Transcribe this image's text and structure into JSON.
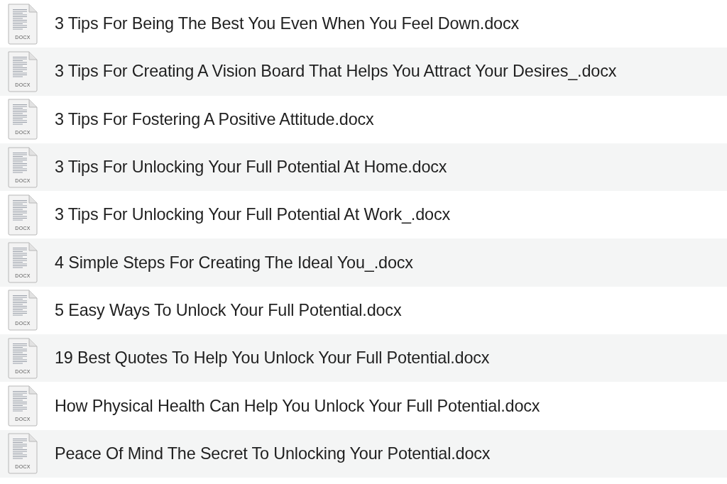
{
  "files": [
    {
      "name": "3 Tips For Being The Best You Even When You Feel Down.docx",
      "type_label": "DOCX"
    },
    {
      "name": "3 Tips For Creating A Vision Board That Helps You Attract Your Desires_.docx",
      "type_label": "DOCX"
    },
    {
      "name": "3 Tips For Fostering A Positive Attitude.docx",
      "type_label": "DOCX"
    },
    {
      "name": "3 Tips For Unlocking Your Full Potential At Home.docx",
      "type_label": "DOCX"
    },
    {
      "name": "3 Tips For Unlocking Your Full Potential At Work_.docx",
      "type_label": "DOCX"
    },
    {
      "name": "4 Simple Steps For Creating The Ideal You_.docx",
      "type_label": "DOCX"
    },
    {
      "name": "5 Easy Ways To Unlock Your Full Potential.docx",
      "type_label": "DOCX"
    },
    {
      "name": "19 Best Quotes To Help You Unlock Your Full Potential.docx",
      "type_label": "DOCX"
    },
    {
      "name": "How Physical Health Can Help You Unlock Your Full Potential.docx",
      "type_label": "DOCX"
    },
    {
      "name": "Peace Of Mind The Secret To Unlocking Your Potential.docx",
      "type_label": "DOCX"
    }
  ]
}
